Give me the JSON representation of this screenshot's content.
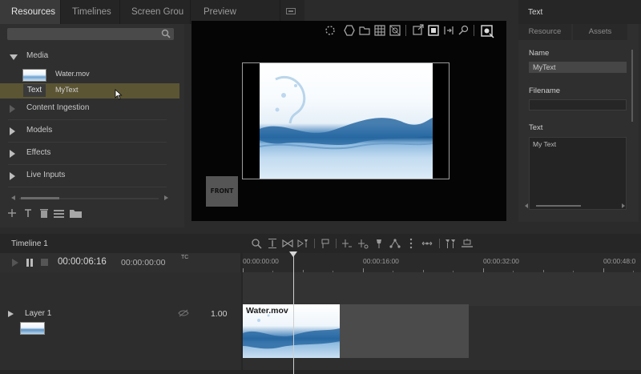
{
  "tabs": [
    {
      "label": "Resources",
      "active": true
    },
    {
      "label": "Timelines",
      "active": false
    },
    {
      "label": "Screen Grou",
      "active": false
    },
    {
      "label": "Preview",
      "active": false
    }
  ],
  "resources": {
    "search_placeholder": "",
    "tree": [
      {
        "label": "Media",
        "expanded": true
      },
      {
        "label": "Content Ingestion",
        "expanded": false,
        "disabled": true
      },
      {
        "label": "Models",
        "expanded": false
      },
      {
        "label": "Effects",
        "expanded": false
      },
      {
        "label": "Live Inputs",
        "expanded": false
      }
    ],
    "media_items": [
      {
        "thumb": "water-thumbnail",
        "label": "Water.mov",
        "selected": false
      },
      {
        "thumb": "Text",
        "label": "MyText",
        "selected": true
      }
    ]
  },
  "preview": {
    "front_label": "FRONT"
  },
  "inspector": {
    "title": "Text",
    "tabs": [
      "Resource",
      "Assets"
    ],
    "name_label": "Name",
    "name_value": "MyText",
    "filename_label": "Filename",
    "filename_value": "",
    "text_label": "Text",
    "text_value": "My Text"
  },
  "timeline": {
    "title": "Timeline 1",
    "current_time": "00:00:06:16",
    "duration": "00:00:00:00",
    "tc_label": "TC",
    "ruler": [
      "00:00:00:00",
      "00:00:16:00",
      "00:00:32:00",
      "00:00:48:0"
    ],
    "layer": {
      "name": "Layer 1",
      "opacity": "1.00"
    },
    "clip": {
      "label": "Water.mov"
    }
  },
  "colors": {
    "selection": "#5b5534",
    "background": "#2b2b2b",
    "preview_bg": "#050505"
  }
}
